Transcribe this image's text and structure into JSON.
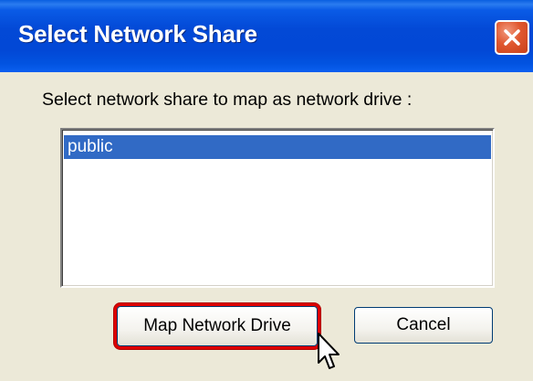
{
  "window": {
    "title": "Select Network Share"
  },
  "dialog": {
    "prompt": "Select network share to map as network drive :",
    "shares": [
      {
        "label": "public",
        "selected": true
      }
    ]
  },
  "buttons": {
    "map_label": "Map Network Drive",
    "cancel_label": "Cancel"
  },
  "icons": {
    "close": "close-icon",
    "cursor": "mouse-pointer-icon"
  },
  "colors": {
    "titlebar": "#0349d6",
    "selection": "#316ac5",
    "highlight_border": "#dd0000",
    "dialog_bg": "#ece9d8"
  }
}
